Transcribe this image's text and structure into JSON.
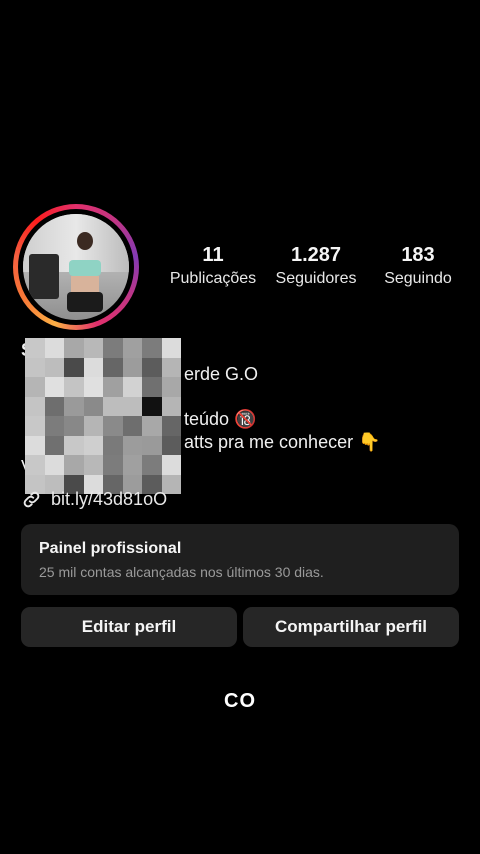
{
  "profile": {
    "stats": [
      {
        "value": "11",
        "label": "Publicações"
      },
      {
        "value": "1.287",
        "label": "Seguidores"
      },
      {
        "value": "183",
        "label": "Seguindo"
      }
    ],
    "bio_lines": [
      {
        "prefix": "S",
        "text": ""
      },
      {
        "prefix": "",
        "text": "erde G.O"
      },
      {
        "prefix": "",
        "text": "teúdo 🔞"
      },
      {
        "prefix": "",
        "text": "atts pra me conhecer 👇"
      },
      {
        "prefix": "V",
        "text": ""
      }
    ],
    "link": "bit.ly/43d81oO",
    "link_icon": "link-icon"
  },
  "professional_panel": {
    "title": "Painel profissional",
    "subtitle": "25 mil contas alcançadas nos últimos 30 dias."
  },
  "buttons": {
    "edit": "Editar perfil",
    "share": "Compartilhar perfil"
  },
  "caption": "CO",
  "colors": {
    "background": "#000000",
    "panel": "#1f1f1f",
    "button": "#262626"
  }
}
